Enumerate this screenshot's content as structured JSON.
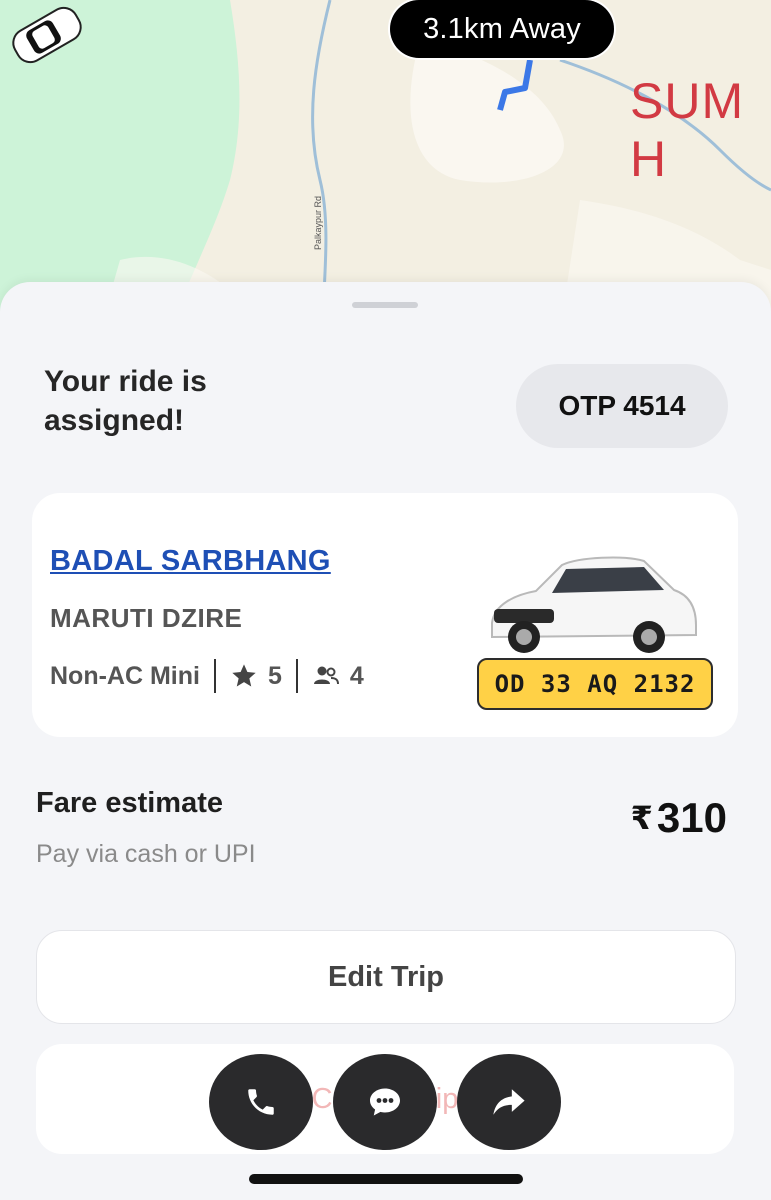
{
  "map": {
    "distance_label": "3.1km Away",
    "place_label": "SUM H",
    "road_label": "Palkaypur Rd"
  },
  "ride": {
    "status_title": "Your ride is assigned!",
    "otp_label": "OTP 4514"
  },
  "driver": {
    "name": "BADAL SARBHANG",
    "car_model": "MARUTI DZIRE",
    "category": "Non-AC Mini",
    "rating": "5",
    "seats": "4",
    "plate_number": "OD 33 AQ 2132"
  },
  "fare": {
    "title": "Fare estimate",
    "subtitle": "Pay via cash or UPI",
    "currency_symbol": "₹",
    "amount": "310"
  },
  "buttons": {
    "edit_trip": "Edit Trip",
    "cancel_partial": "Cancel Trip"
  },
  "icons": {
    "call": "phone-icon",
    "chat": "chat-icon",
    "share": "share-icon",
    "rating": "star-icon",
    "seats": "people-icon"
  },
  "colors": {
    "driver_name": "#1e4fb5",
    "plate_bg": "#ffd146",
    "action_btn": "#2a2a2c",
    "map_place_label": "#d23a43"
  }
}
